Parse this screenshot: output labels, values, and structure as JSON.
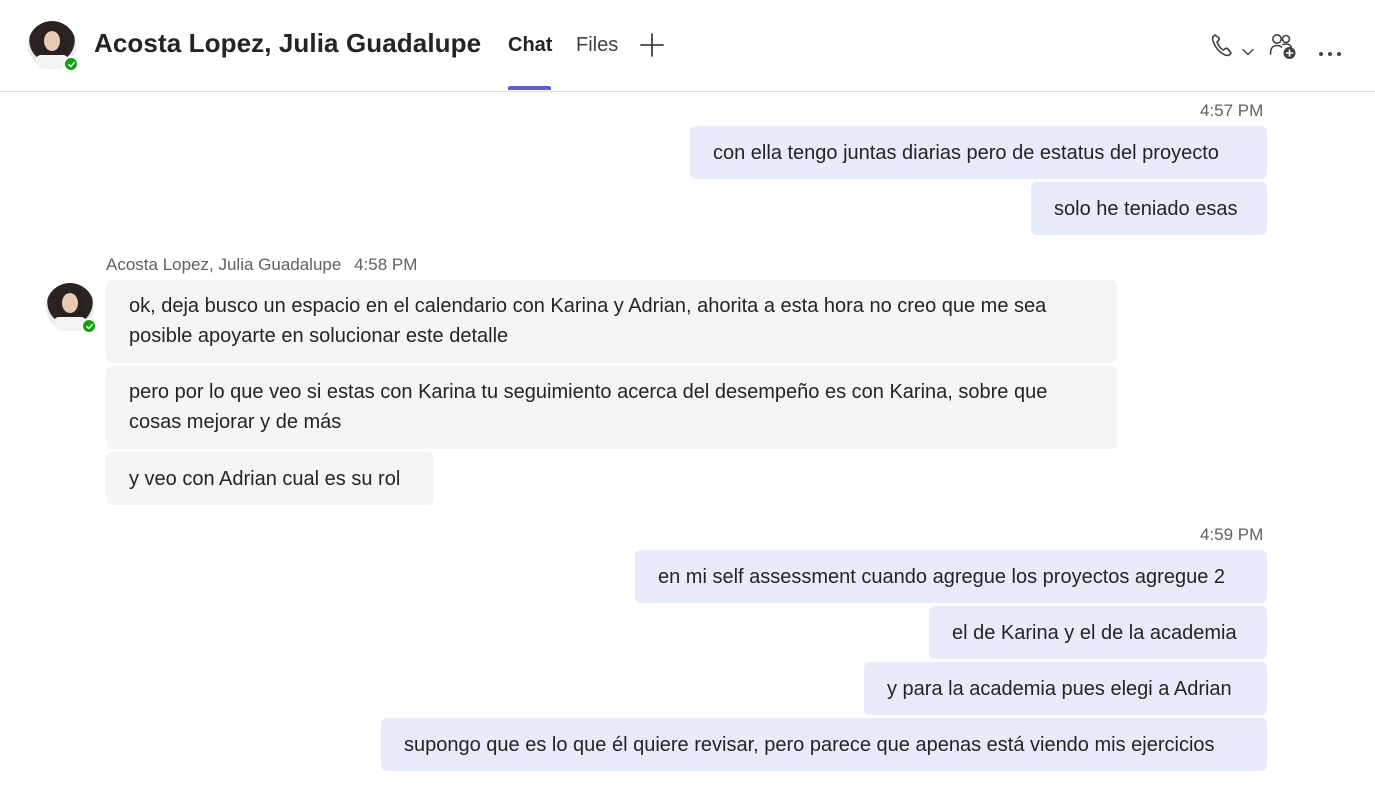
{
  "header": {
    "contact_name": "Acosta Lopez, Julia Guadalupe",
    "tabs": [
      {
        "label": "Chat",
        "active": true
      },
      {
        "label": "Files",
        "active": false
      }
    ],
    "icons": [
      "add-tab-icon",
      "call-icon",
      "chevron-down-icon",
      "add-people-icon",
      "more-options-icon"
    ],
    "presence_status_color": "#13a10e",
    "accent_color": "#5b5fc7"
  },
  "messages": {
    "group1": {
      "time": "4:57 PM",
      "items": [
        "con ella tengo juntas diarias pero de estatus del proyecto",
        "solo he teniado esas"
      ]
    },
    "group2": {
      "sender": "Acosta Lopez, Julia Guadalupe",
      "time": "4:58 PM",
      "items": [
        "ok, deja busco un espacio en el calendario con Karina y Adrian, ahorita a esta hora no creo que me sea posible apoyarte en solucionar este detalle",
        "pero por lo que veo si estas con Karina tu seguimiento acerca del desempeño es con Karina, sobre que cosas mejorar y de más",
        "y veo con Adrian cual es su rol"
      ]
    },
    "group3": {
      "time": "4:59 PM",
      "items": [
        "en mi self assessment cuando agregue los proyectos agregue 2",
        "el de Karina y el de la academia",
        "y para la academia pues elegi a Adrian",
        "supongo que es lo que él quiere revisar, pero parece que apenas está viendo mis ejercicios"
      ]
    }
  },
  "colors": {
    "my_bubble": "#e8ebfa",
    "their_bubble": "#f5f5f5"
  }
}
